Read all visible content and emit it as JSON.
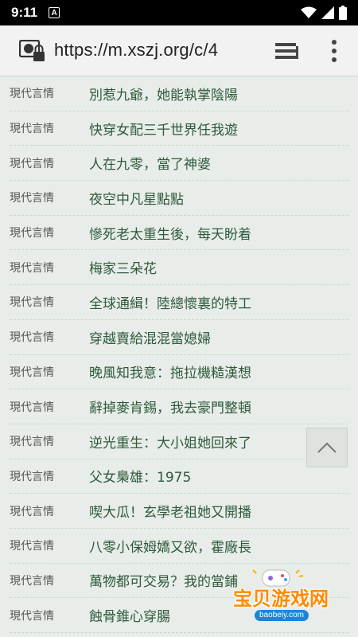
{
  "status_bar": {
    "time": "9:11",
    "notification_icon": "A"
  },
  "url_bar": {
    "url": "https://m.xszj.org/c/4"
  },
  "rows": [
    {
      "category": "現代言情",
      "title": "別惹九爺，她能執掌陰陽"
    },
    {
      "category": "現代言情",
      "title": "快穿女配三千世界任我遊"
    },
    {
      "category": "現代言情",
      "title": "人在九零，當了神婆"
    },
    {
      "category": "現代言情",
      "title": "夜空中凡星點點"
    },
    {
      "category": "現代言情",
      "title": "慘死老太重生後，每天盼着"
    },
    {
      "category": "現代言情",
      "title": "梅家三朵花"
    },
    {
      "category": "現代言情",
      "title": "全球通緝！陸總懷裏的特工"
    },
    {
      "category": "現代言情",
      "title": "穿越賣給混混當媳婦"
    },
    {
      "category": "現代言情",
      "title": "晚風知我意：拖拉機糙漢想"
    },
    {
      "category": "現代言情",
      "title": "辭掉麥肯錫，我去豪門整頓"
    },
    {
      "category": "現代言情",
      "title": "逆光重生：大小姐她回來了"
    },
    {
      "category": "現代言情",
      "title": "父女梟雄：1975"
    },
    {
      "category": "現代言情",
      "title": "喫大瓜！玄學老祖她又開播"
    },
    {
      "category": "現代言情",
      "title": "八零小保姆嬌又欲，霍廠長"
    },
    {
      "category": "現代言情",
      "title": "萬物都可交易？我的當鋪"
    },
    {
      "category": "現代言情",
      "title": "蝕骨錐心穿腸"
    }
  ],
  "watermark": {
    "text": "宝贝游戏网",
    "url": "baobeiy.com"
  },
  "icons": {
    "site": "secure-site-icon",
    "tabs": "tabs-stack-icon",
    "menu": "more-vert-icon",
    "scroll_top": "chevron-up-icon",
    "wifi": "wifi-icon",
    "signal": "signal-icon",
    "battery": "battery-icon"
  }
}
